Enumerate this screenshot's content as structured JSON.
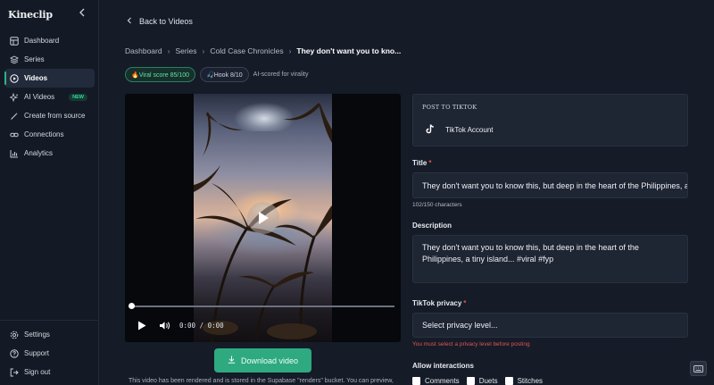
{
  "app": {
    "brand": "Kineclip"
  },
  "sidebar": {
    "items": [
      {
        "label": "Dashboard",
        "icon": "dashboard-icon"
      },
      {
        "label": "Series",
        "icon": "layers-icon"
      },
      {
        "label": "Videos",
        "icon": "play-circle-icon",
        "active": true
      },
      {
        "label": "AI Videos",
        "icon": "sparkles-icon",
        "badge": "NEW"
      },
      {
        "label": "Create from source",
        "icon": "magic-wand-icon"
      },
      {
        "label": "Connections",
        "icon": "link-icon"
      },
      {
        "label": "Analytics",
        "icon": "bar-chart-icon"
      }
    ],
    "bottom_items": [
      {
        "label": "Settings",
        "icon": "gear-icon"
      },
      {
        "label": "Support",
        "icon": "help-circle-icon"
      },
      {
        "label": "Sign out",
        "icon": "logout-icon"
      }
    ]
  },
  "header": {
    "back_label": "Back to Videos",
    "breadcrumbs": [
      "Dashboard",
      "Series",
      "Cold Case Chronicles",
      "They don't want you to kno..."
    ]
  },
  "scores": {
    "viral": "🔥Viral score 85/100",
    "hook": "🎣Hook 8/10",
    "note": "AI-scored for virality"
  },
  "player": {
    "time": "0:00 / 0:00",
    "progress": 0
  },
  "download": {
    "label": "Download video",
    "note": "This video has been rendered and is stored in the Supabase \"renders\" bucket. You can preview,"
  },
  "post": {
    "title": "POST TO TIKTOK",
    "account": "TikTok Account"
  },
  "form": {
    "title_label": "Title",
    "title_value": "They don't want you to know this, but deep in the heart of the Philippines, a tiny island... #viral #fyp",
    "title_count": "102/150 characters",
    "description_label": "Description",
    "description_value": "They don't want you to know this, but deep in the heart of the Philippines, a tiny island... #viral #fyp",
    "privacy_label": "TikTok privacy",
    "privacy_placeholder": "Select privacy level...",
    "privacy_error": "You must select a privacy level before posting",
    "interactions_label": "Allow interactions",
    "interactions": [
      "Comments",
      "Duets",
      "Stitches"
    ]
  },
  "colors": {
    "accent": "#2fa980",
    "error": "#e05454",
    "background": "#151b27"
  }
}
